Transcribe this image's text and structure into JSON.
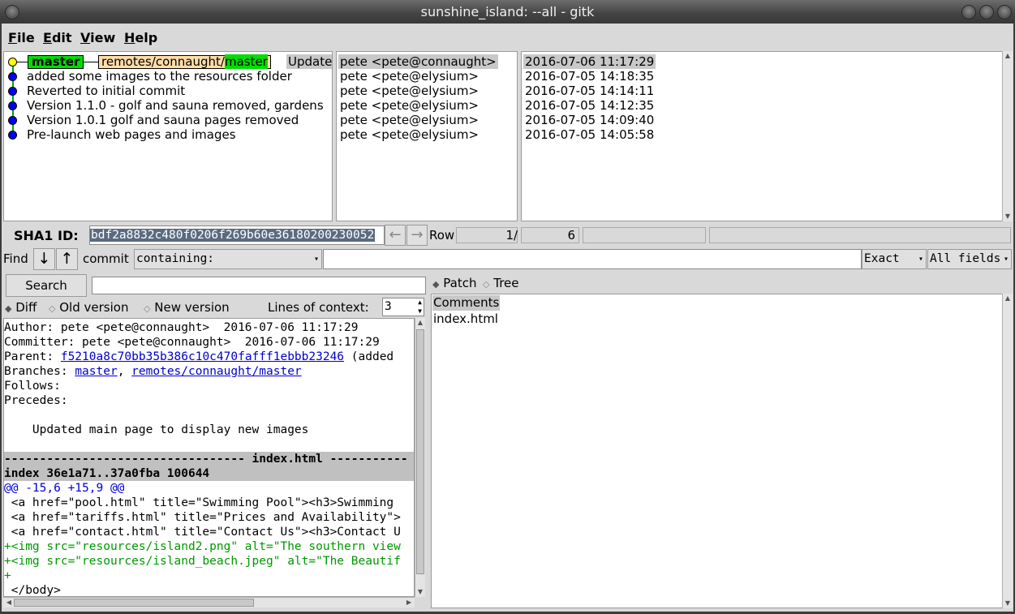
{
  "window": {
    "title": "sunshine_island: --all - gitk"
  },
  "menu": {
    "file": "File",
    "file_u": "F",
    "file_rest": "ile",
    "edit": "Edit",
    "edit_u": "E",
    "edit_rest": "dit",
    "view": "View",
    "view_u": "V",
    "view_rest": "iew",
    "help": "Help",
    "help_u": "H",
    "help_rest": "elp"
  },
  "history": {
    "head_tag": "master",
    "remote_tag_prefix": "remotes/connaught/",
    "remote_tag_branch": "master",
    "commits": [
      {
        "subject": "Update",
        "author": "pete <pete@connaught>",
        "date": "2016-07-06 11:17:29"
      },
      {
        "subject": "added some images to the resources folder",
        "author": "pete <pete@elysium>",
        "date": "2016-07-05 14:18:35"
      },
      {
        "subject": "Reverted to initial commit",
        "author": "pete <pete@elysium>",
        "date": "2016-07-05 14:14:11"
      },
      {
        "subject": "Version 1.1.0 - golf and sauna removed, gardens",
        "author": "pete <pete@elysium>",
        "date": "2016-07-05 14:12:35"
      },
      {
        "subject": "Version 1.0.1 golf and sauna pages removed",
        "author": "pete <pete@elysium>",
        "date": "2016-07-05 14:09:40"
      },
      {
        "subject": "Pre-launch web pages and images",
        "author": "pete <pete@elysium>",
        "date": "2016-07-05 14:05:58"
      }
    ]
  },
  "sha": {
    "label": "SHA1 ID:",
    "value": "bdf2a8832c480f0206f269b60e36180200230052",
    "row_label": "Row",
    "row_current": "1",
    "row_sep": "/",
    "row_total": "6"
  },
  "find": {
    "label": "Find",
    "commit_label": "commit",
    "mode": "containing:",
    "query": "",
    "match": "Exact",
    "fields": "All fields"
  },
  "search": {
    "button": "Search",
    "query": ""
  },
  "diff_options": {
    "diff": "Diff",
    "old_version": "Old version",
    "new_version": "New version",
    "context_label": "Lines of context:",
    "context_value": "3"
  },
  "file_view": {
    "patch": "Patch",
    "tree": "Tree",
    "files": [
      "Comments",
      "index.html"
    ]
  },
  "details": {
    "author": "Author: pete <pete@connaught>  2016-07-06 11:17:29",
    "committer": "Committer: pete <pete@connaught>  2016-07-06 11:17:29",
    "parent_label": "Parent: ",
    "parent_sha": "f5210a8c70bb35b386c10c470fafff1ebbb23246",
    "parent_rest": " (added",
    "branches_label": "Branches: ",
    "branch1": "master",
    "branch_sep": ", ",
    "branch2": "remotes/connaught/master",
    "follows": "Follows:",
    "precedes": "Precedes:",
    "message": "    Updated main page to display new images",
    "file_header": "---------------------------------- index.html -----------",
    "index_line": "index 36e1a71..37a0fba 100644",
    "hunk": "@@ -15,6 +15,9 @@",
    "ctx1": " <a href=\"pool.html\" title=\"Swimming Pool\"><h3>Swimming",
    "ctx2": " <a href=\"tariffs.html\" title=\"Prices and Availability\">",
    "ctx3": " <a href=\"contact.html\" title=\"Contact Us\"><h3>Contact U",
    "add1": "+<img src=\"resources/island2.png\" alt=\"The southern view",
    "add2": "+<img src=\"resources/island_beach.jpeg\" alt=\"The Beautif",
    "add3": "+",
    "ctx4": " </body>"
  }
}
